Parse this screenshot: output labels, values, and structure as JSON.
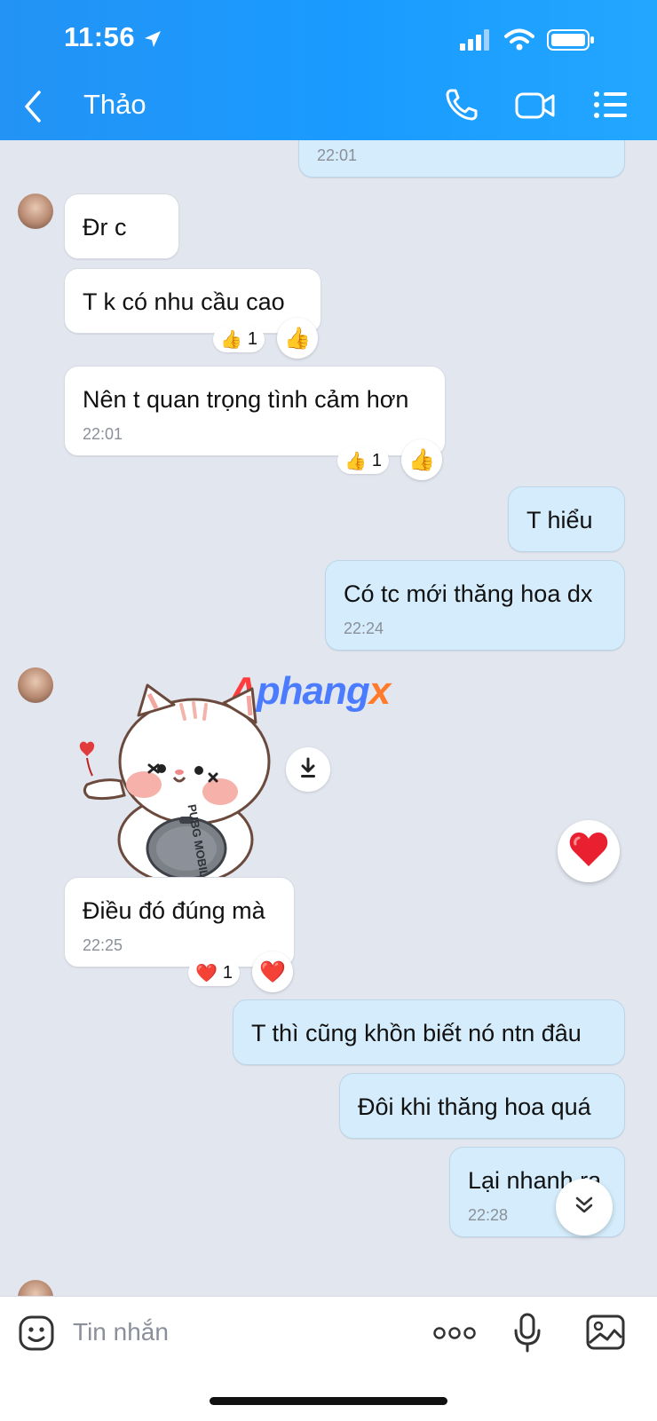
{
  "status_bar": {
    "time": "11:56"
  },
  "header": {
    "contact_name": "Thảo",
    "accent": "#1a9bff"
  },
  "messages": {
    "m0": {
      "time": "22:01"
    },
    "m1": {
      "text": "Đr c"
    },
    "m2": {
      "text": "T k có nhu cầu cao",
      "reaction_emoji": "👍",
      "reaction_count": "1"
    },
    "m3": {
      "text": "Nên t quan trọng tình cảm hơn",
      "time": "22:01",
      "reaction_emoji": "👍",
      "reaction_count": "1"
    },
    "m4": {
      "text": "T hiểu"
    },
    "m5": {
      "text": "Có tc mới thăng hoa dx",
      "time": "22:24"
    },
    "m6": {
      "sticker": "cat-sticker",
      "sticker_text": "PUBG MOBILE"
    },
    "m7": {
      "text": "Điều đó đúng mà",
      "time": "22:25",
      "reaction_emoji": "❤️",
      "reaction_count": "1"
    },
    "m8": {
      "text": "T thì cũng khồn biết nó ntn đâu"
    },
    "m9": {
      "text": "Đôi khi thăng hoa quá"
    },
    "m10": {
      "text": "Lại nhanh ra",
      "time": "22:28"
    }
  },
  "watermark": {
    "part1": "A",
    "part2": "phang",
    "part3": "x"
  },
  "composer": {
    "placeholder": "Tin nhắn"
  },
  "icons": [
    "back-icon",
    "phone-icon",
    "video-icon",
    "menu-icon",
    "emoji-icon",
    "more-icon",
    "mic-icon",
    "image-icon",
    "download-icon",
    "heart-icon",
    "chevron-double-down-icon"
  ]
}
